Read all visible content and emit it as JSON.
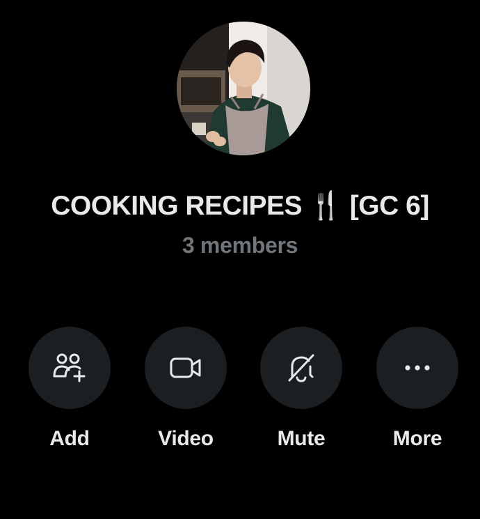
{
  "group": {
    "title": "COOKING RECIPES 🍴 [GC 6]",
    "members": "3 members"
  },
  "actions": [
    {
      "label": "Add",
      "icon": "add-person-icon"
    },
    {
      "label": "Video",
      "icon": "video-camera-icon"
    },
    {
      "label": "Mute",
      "icon": "bell-off-icon"
    },
    {
      "label": "More",
      "icon": "more-dots-icon"
    }
  ],
  "colors": {
    "background": "#000000",
    "primary_text": "#e7e9ea",
    "secondary_text": "#71767b",
    "button_bg": "#1c1f22"
  }
}
